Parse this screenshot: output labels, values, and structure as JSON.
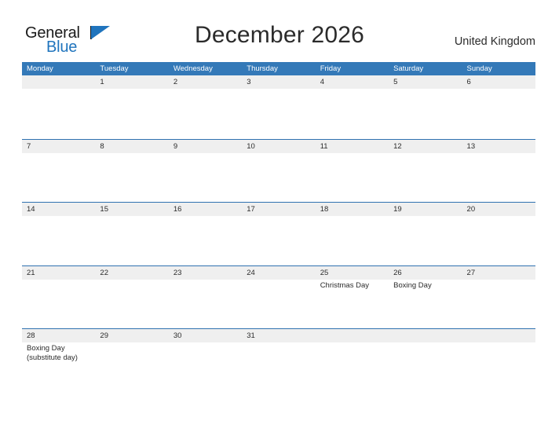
{
  "brand": {
    "name_part1": "General",
    "name_part2": "Blue",
    "flag_icon": "flag-triangle-icon",
    "colors": {
      "blue": "#1f74bd",
      "dark": "#1a1a1a"
    }
  },
  "header": {
    "title": "December 2026",
    "region": "United Kingdom"
  },
  "calendar": {
    "accent_color": "#3479b8",
    "band_color": "#efefef",
    "weekdays": [
      "Monday",
      "Tuesday",
      "Wednesday",
      "Thursday",
      "Friday",
      "Saturday",
      "Sunday"
    ],
    "weeks": [
      {
        "days": [
          {
            "date": "",
            "events": []
          },
          {
            "date": "1",
            "events": []
          },
          {
            "date": "2",
            "events": []
          },
          {
            "date": "3",
            "events": []
          },
          {
            "date": "4",
            "events": []
          },
          {
            "date": "5",
            "events": []
          },
          {
            "date": "6",
            "events": []
          }
        ]
      },
      {
        "days": [
          {
            "date": "7",
            "events": []
          },
          {
            "date": "8",
            "events": []
          },
          {
            "date": "9",
            "events": []
          },
          {
            "date": "10",
            "events": []
          },
          {
            "date": "11",
            "events": []
          },
          {
            "date": "12",
            "events": []
          },
          {
            "date": "13",
            "events": []
          }
        ]
      },
      {
        "days": [
          {
            "date": "14",
            "events": []
          },
          {
            "date": "15",
            "events": []
          },
          {
            "date": "16",
            "events": []
          },
          {
            "date": "17",
            "events": []
          },
          {
            "date": "18",
            "events": []
          },
          {
            "date": "19",
            "events": []
          },
          {
            "date": "20",
            "events": []
          }
        ]
      },
      {
        "days": [
          {
            "date": "21",
            "events": []
          },
          {
            "date": "22",
            "events": []
          },
          {
            "date": "23",
            "events": []
          },
          {
            "date": "24",
            "events": []
          },
          {
            "date": "25",
            "events": [
              "Christmas Day"
            ]
          },
          {
            "date": "26",
            "events": [
              "Boxing Day"
            ]
          },
          {
            "date": "27",
            "events": []
          }
        ]
      },
      {
        "days": [
          {
            "date": "28",
            "events": [
              "Boxing Day",
              "(substitute day)"
            ]
          },
          {
            "date": "29",
            "events": []
          },
          {
            "date": "30",
            "events": []
          },
          {
            "date": "31",
            "events": []
          },
          {
            "date": "",
            "events": []
          },
          {
            "date": "",
            "events": []
          },
          {
            "date": "",
            "events": []
          }
        ]
      }
    ]
  }
}
